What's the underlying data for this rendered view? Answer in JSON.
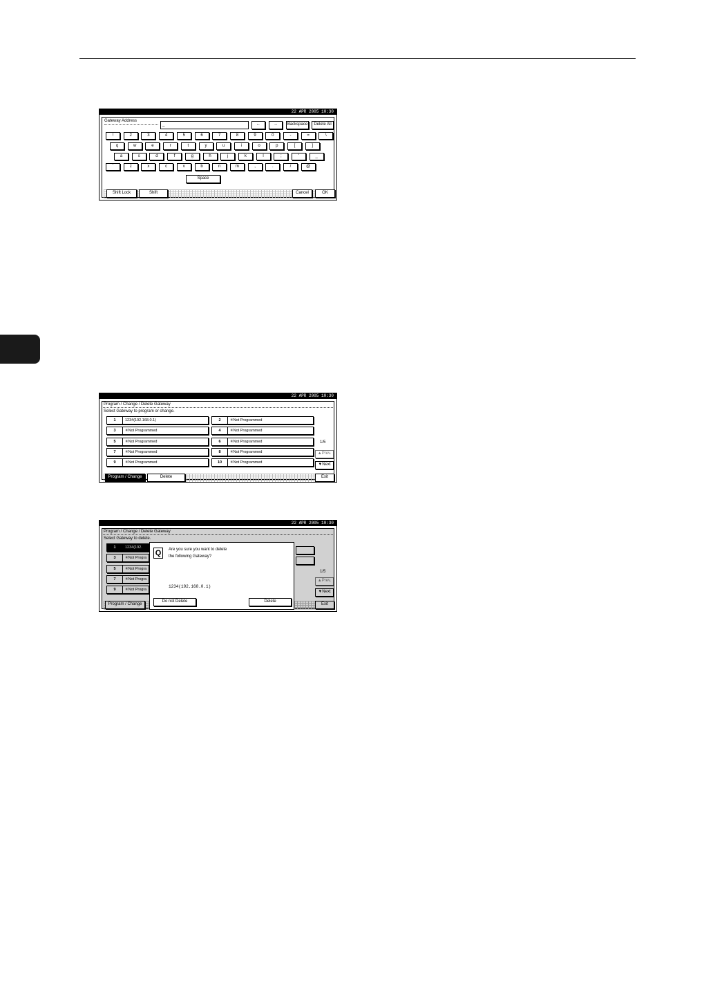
{
  "clock": "22 APR  2005 10:30",
  "keyboard": {
    "label": "Gateway Address",
    "input_value": "_",
    "left_arrow": "←",
    "right_arrow": "→",
    "backspace": "Backspace",
    "delete_all": "Delete All",
    "rows": [
      [
        "!",
        "2",
        "3",
        "4",
        "5",
        "6",
        "7",
        "8",
        "9",
        "0",
        "-",
        "=",
        "\\"
      ],
      [
        "q",
        "w",
        "e",
        "r",
        "t",
        "y",
        "u",
        "i",
        "o",
        "p",
        "[",
        "]"
      ],
      [
        "a",
        "s",
        "d",
        "f",
        "g",
        "h",
        "j",
        "k",
        "l",
        ";",
        "'",
        "_"
      ],
      [
        "`",
        "z",
        "x",
        "c",
        "v",
        "b",
        "n",
        "m",
        ",",
        ".",
        "/",
        "@"
      ]
    ],
    "space": "Space",
    "shift_lock": "Shift Lock",
    "shift": "Shift",
    "cancel": "Cancel",
    "ok": "OK"
  },
  "list_screen": {
    "title": "Program / Change / Delete Gateway",
    "instruction": "Select Gateway to program or change.",
    "entries": [
      {
        "num": "1",
        "label": "1234(192.168.0.1)"
      },
      {
        "num": "2",
        "label": "✳Not Programmed"
      },
      {
        "num": "3",
        "label": "✳Not Programmed"
      },
      {
        "num": "4",
        "label": "✳Not Programmed"
      },
      {
        "num": "5",
        "label": "✳Not Programmed"
      },
      {
        "num": "6",
        "label": "✳Not Programmed"
      },
      {
        "num": "7",
        "label": "✳Not Programmed"
      },
      {
        "num": "8",
        "label": "✳Not Programmed"
      },
      {
        "num": "9",
        "label": "✳Not Programmed"
      },
      {
        "num": "10",
        "label": "✳Not Programmed"
      }
    ],
    "page": "1/5",
    "prev": "▲Prev.",
    "next": "▼Next",
    "program_change": "Program / Change",
    "delete": "Delete",
    "exit": "Exit"
  },
  "delete_screen": {
    "title": "Program / Change / Delete Gateway",
    "instruction": "Select Gateway to delete.",
    "entries": [
      {
        "num": "1",
        "label": "1234(192."
      },
      {
        "num": "3",
        "label": "✳Not Progra"
      },
      {
        "num": "5",
        "label": "✳Not Progra"
      },
      {
        "num": "7",
        "label": "✳Not Progra"
      },
      {
        "num": "9",
        "label": "✳Not Progra"
      }
    ],
    "page": "1/5",
    "prev": "▲Prev.",
    "next": "▼Next",
    "program_change": "Program / Change",
    "exit": "Exit",
    "dialog": {
      "icon": "Q",
      "line1": "Are you sure you want to delete",
      "line2": "the following Gateway?",
      "value": "1234(192.168.0.1)",
      "do_not_delete": "Do not Delete",
      "delete": "Delete"
    }
  }
}
